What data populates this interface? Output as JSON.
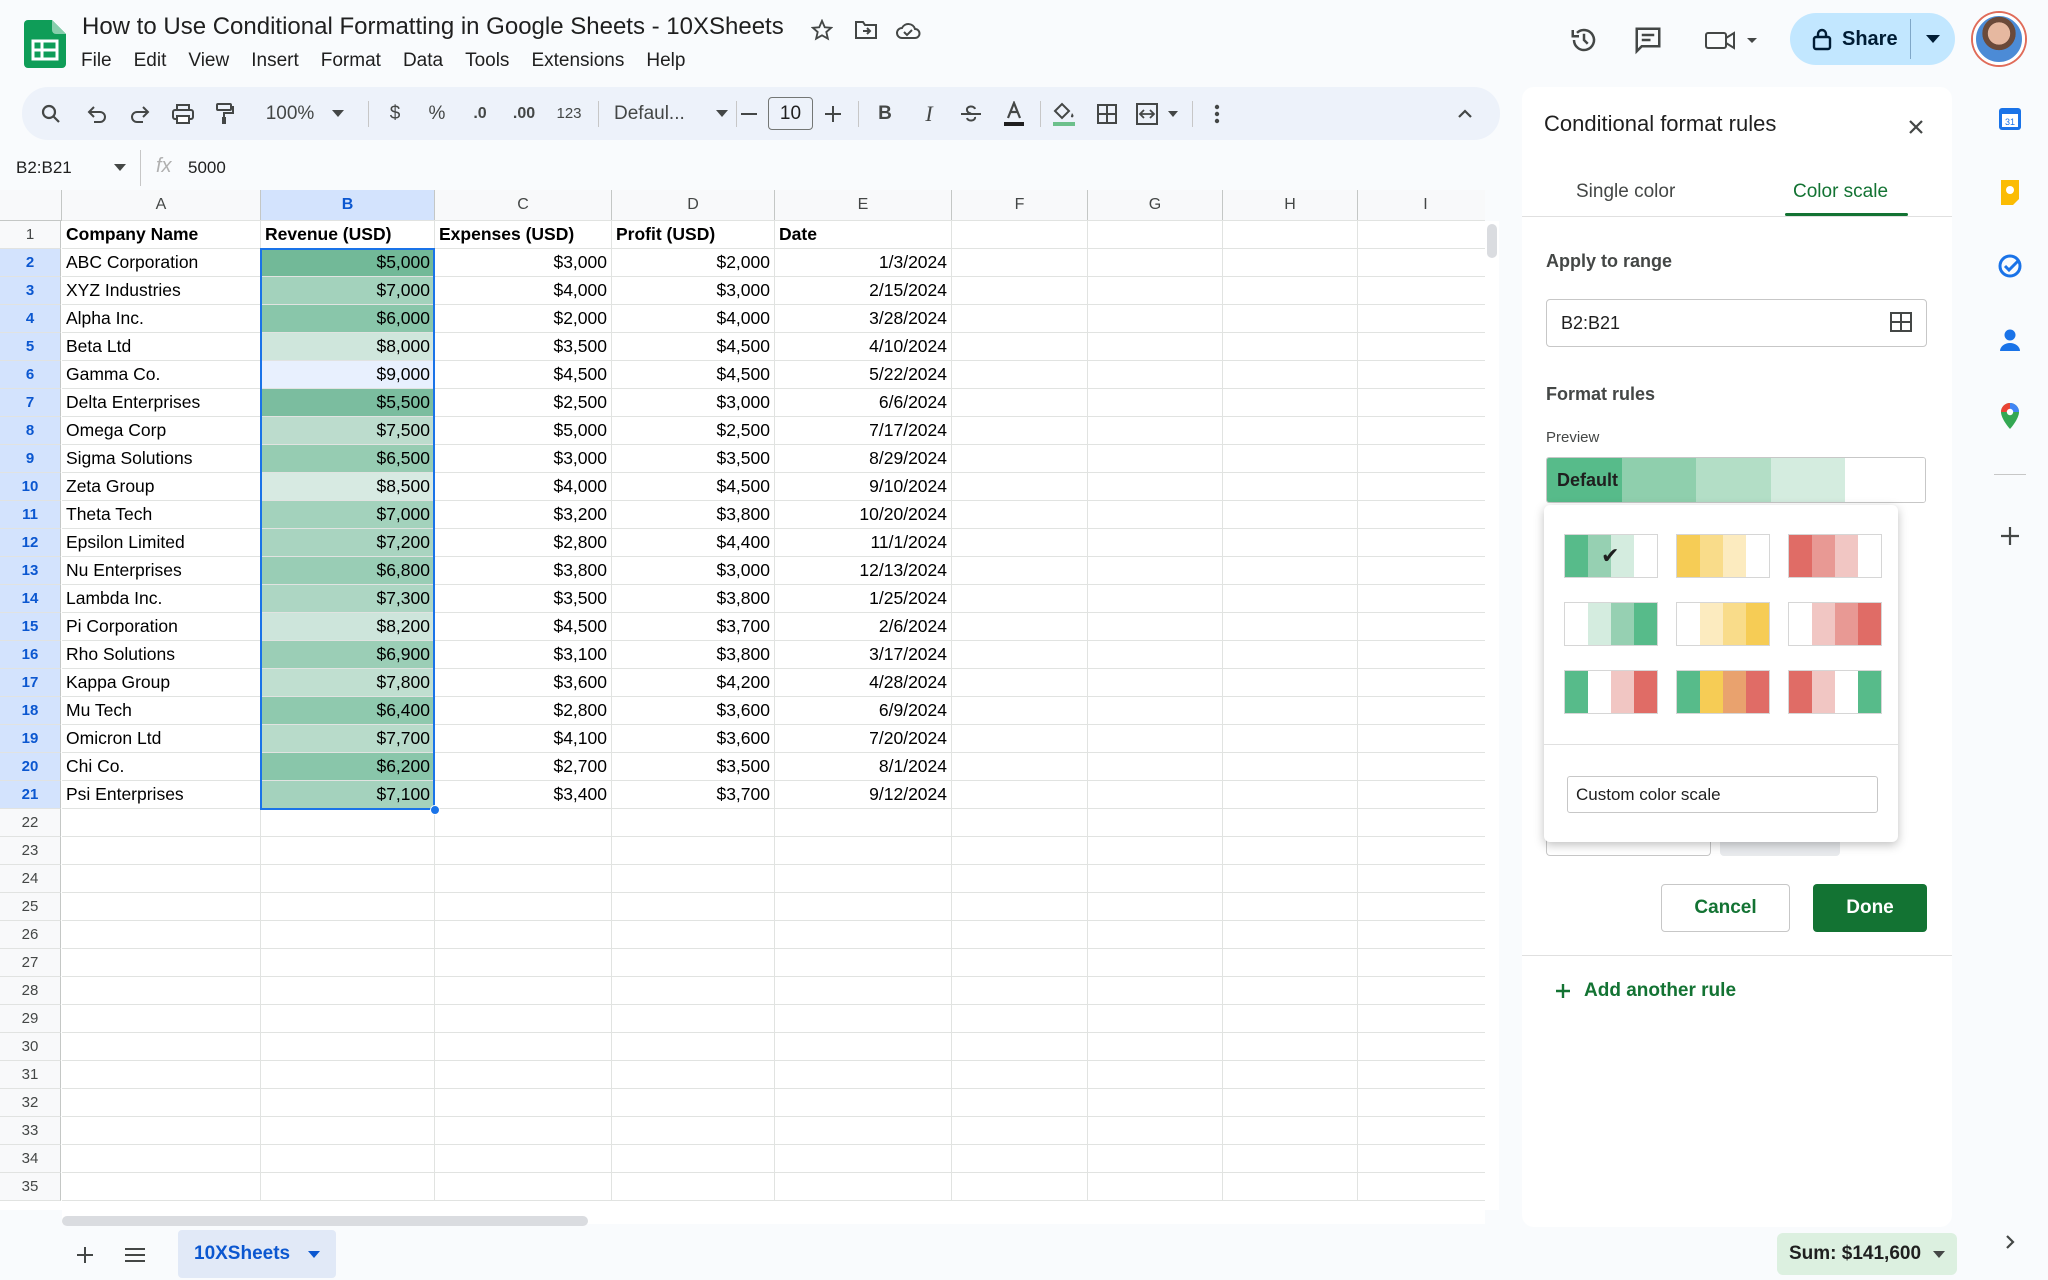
{
  "app": {
    "doc_title": "How to Use Conditional Formatting in Google Sheets - 10XSheets",
    "menu": [
      "File",
      "Edit",
      "View",
      "Insert",
      "Format",
      "Data",
      "Tools",
      "Extensions",
      "Help"
    ],
    "share_label": "Share"
  },
  "toolbar": {
    "zoom": "100%",
    "currency": "$",
    "percent": "%",
    "dec_decrease": ".0",
    "dec_increase": ".00",
    "number_format": "123",
    "font": "Defaul...",
    "font_size": "10",
    "bold": "B",
    "italic": "I"
  },
  "formula_bar": {
    "name_box": "B2:B21",
    "fx": "fx",
    "value": "5000"
  },
  "grid": {
    "columns": [
      "A",
      "B",
      "C",
      "D",
      "E",
      "F",
      "G",
      "H",
      "I"
    ],
    "headers": [
      "Company Name",
      "Revenue (USD)",
      "Expenses (USD)",
      "Profit (USD)",
      "Date"
    ],
    "rows": [
      [
        "ABC Corporation",
        "$5,000",
        "$3,000",
        "$2,000",
        "1/3/2024"
      ],
      [
        "XYZ Industries",
        "$7,000",
        "$4,000",
        "$3,000",
        "2/15/2024"
      ],
      [
        "Alpha Inc.",
        "$6,000",
        "$2,000",
        "$4,000",
        "3/28/2024"
      ],
      [
        "Beta Ltd",
        "$8,000",
        "$3,500",
        "$4,500",
        "4/10/2024"
      ],
      [
        "Gamma Co.",
        "$9,000",
        "$4,500",
        "$4,500",
        "5/22/2024"
      ],
      [
        "Delta Enterprises",
        "$5,500",
        "$2,500",
        "$3,000",
        "6/6/2024"
      ],
      [
        "Omega Corp",
        "$7,500",
        "$5,000",
        "$2,500",
        "7/17/2024"
      ],
      [
        "Sigma Solutions",
        "$6,500",
        "$3,000",
        "$3,500",
        "8/29/2024"
      ],
      [
        "Zeta Group",
        "$8,500",
        "$4,000",
        "$4,500",
        "9/10/2024"
      ],
      [
        "Theta Tech",
        "$7,000",
        "$3,200",
        "$3,800",
        "10/20/2024"
      ],
      [
        "Epsilon Limited",
        "$7,200",
        "$2,800",
        "$4,400",
        "11/1/2024"
      ],
      [
        "Nu Enterprises",
        "$6,800",
        "$3,800",
        "$3,000",
        "12/13/2024"
      ],
      [
        "Lambda Inc.",
        "$7,300",
        "$3,500",
        "$3,800",
        "1/25/2024"
      ],
      [
        "Pi Corporation",
        "$8,200",
        "$4,500",
        "$3,700",
        "2/6/2024"
      ],
      [
        "Rho Solutions",
        "$6,900",
        "$3,100",
        "$3,800",
        "3/17/2024"
      ],
      [
        "Kappa Group",
        "$7,800",
        "$3,600",
        "$4,200",
        "4/28/2024"
      ],
      [
        "Mu Tech",
        "$6,400",
        "$2,800",
        "$3,600",
        "6/9/2024"
      ],
      [
        "Omicron Ltd",
        "$7,700",
        "$4,100",
        "$3,600",
        "7/20/2024"
      ],
      [
        "Chi Co.",
        "$6,200",
        "$2,700",
        "$3,500",
        "8/1/2024"
      ],
      [
        "Psi Enterprises",
        "$7,100",
        "$3,400",
        "$3,700",
        "9/12/2024"
      ]
    ],
    "revenue_colors": [
      "#72b998",
      "#a3d2bc",
      "#89c6aa",
      "#cfe6dc",
      "#e8f0fe",
      "#7bbd9f",
      "#bcdccd",
      "#96ccb2",
      "#d7eae2",
      "#a3d2bc",
      "#a9d4c0",
      "#99cdb5",
      "#add6c3",
      "#cde5db",
      "#9bceb6",
      "#c0dfd0",
      "#8fc9ae",
      "#b8dbca",
      "#89c6aa",
      "#a4d2bd"
    ],
    "row_count": 35
  },
  "sheet_tab": "10XSheets",
  "sum_label": "Sum: $141,600",
  "panel": {
    "title": "Conditional format rules",
    "tab_single": "Single color",
    "tab_scale": "Color scale",
    "apply_label": "Apply to range",
    "range": "B2:B21",
    "format_rules_label": "Format rules",
    "preview_label": "Preview",
    "preview_text": "Default",
    "preview_colors": [
      "#57bb8a",
      "#8fcfad",
      "#b3dec6",
      "#d4ecdf",
      "#ffffff"
    ],
    "scales": [
      {
        "colors": [
          "#57bb8a",
          "#96d0b2",
          "#d4ecdf",
          "#ffffff"
        ],
        "selected": true
      },
      {
        "colors": [
          "#f6cc55",
          "#f9dc8a",
          "#fcebbf",
          "#ffffff"
        ],
        "selected": false
      },
      {
        "colors": [
          "#e06c66",
          "#e89994",
          "#f1c6c3",
          "#ffffff"
        ],
        "selected": false
      },
      {
        "colors": [
          "#ffffff",
          "#d4ecdf",
          "#96d0b2",
          "#57bb8a"
        ],
        "selected": false
      },
      {
        "colors": [
          "#ffffff",
          "#fcebbf",
          "#f9dc8a",
          "#f6cc55"
        ],
        "selected": false
      },
      {
        "colors": [
          "#ffffff",
          "#f1c6c3",
          "#e89994",
          "#e06c66"
        ],
        "selected": false
      },
      {
        "colors": [
          "#57bb8a",
          "#ffffff",
          "#f1c6c3",
          "#e06c66"
        ],
        "selected": false
      },
      {
        "colors": [
          "#57bb8a",
          "#f6cc55",
          "#e9a26e",
          "#e06c66"
        ],
        "selected": false
      },
      {
        "colors": [
          "#e06c66",
          "#f1c6c3",
          "#ffffff",
          "#57bb8a"
        ],
        "selected": false
      }
    ],
    "custom_label": "Custom color scale",
    "cancel": "Cancel",
    "done": "Done",
    "add_rule": "Add another rule",
    "check": "✔"
  },
  "colors": {
    "accent_green": "#137333",
    "selection_blue": "#1a73e8",
    "share_bg": "#c2e7ff"
  }
}
